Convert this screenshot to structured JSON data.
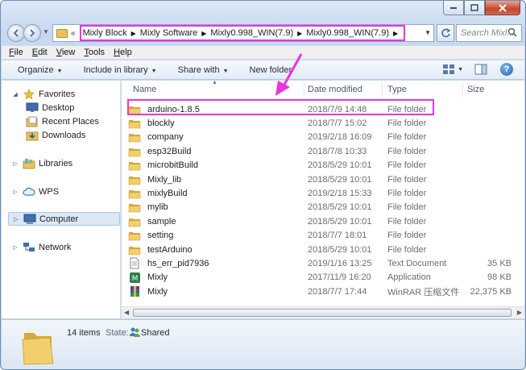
{
  "window": {
    "caption_buttons": [
      "minimize",
      "maximize",
      "close"
    ]
  },
  "address": {
    "breadcrumbs": [
      "Mixly Block",
      "Mixly Software",
      "Mixly0.998_WIN(7.9)",
      "Mixly0.998_WIN(7.9)"
    ],
    "search_placeholder": "Search Mixl..."
  },
  "menu": [
    "File",
    "Edit",
    "View",
    "Tools",
    "Help"
  ],
  "commands": {
    "organize": "Organize",
    "include": "Include in library",
    "share": "Share with",
    "new_folder": "New folder"
  },
  "nav": {
    "favorites": "Favorites",
    "desktop": "Desktop",
    "recent": "Recent Places",
    "downloads": "Downloads",
    "libraries": "Libraries",
    "wps": "WPS",
    "computer": "Computer",
    "network": "Network"
  },
  "columns": {
    "name": "Name",
    "date": "Date modified",
    "type": "Type",
    "size": "Size"
  },
  "files": [
    {
      "name": "arduino-1.8.5",
      "date": "2018/7/9 14:48",
      "type": "File folder",
      "size": "",
      "icon": "folder-icon"
    },
    {
      "name": "blockly",
      "date": "2018/7/7 15:02",
      "type": "File folder",
      "size": "",
      "icon": "folder-icon"
    },
    {
      "name": "company",
      "date": "2019/2/18 16:09",
      "type": "File folder",
      "size": "",
      "icon": "folder-icon"
    },
    {
      "name": "esp32Build",
      "date": "2018/7/8 10:33",
      "type": "File folder",
      "size": "",
      "icon": "folder-icon"
    },
    {
      "name": "microbitBuild",
      "date": "2018/5/29 10:01",
      "type": "File folder",
      "size": "",
      "icon": "folder-icon"
    },
    {
      "name": "Mixly_lib",
      "date": "2018/5/29 10:01",
      "type": "File folder",
      "size": "",
      "icon": "folder-icon"
    },
    {
      "name": "mixlyBuild",
      "date": "2019/2/18 15:33",
      "type": "File folder",
      "size": "",
      "icon": "folder-icon"
    },
    {
      "name": "mylib",
      "date": "2018/5/29 10:01",
      "type": "File folder",
      "size": "",
      "icon": "folder-icon"
    },
    {
      "name": "sample",
      "date": "2018/5/29 10:01",
      "type": "File folder",
      "size": "",
      "icon": "folder-icon"
    },
    {
      "name": "setting",
      "date": "2018/7/7 18:01",
      "type": "File folder",
      "size": "",
      "icon": "folder-icon"
    },
    {
      "name": "testArduino",
      "date": "2018/5/29 10:01",
      "type": "File folder",
      "size": "",
      "icon": "folder-icon"
    },
    {
      "name": "hs_err_pid7936",
      "date": "2019/1/16 13:25",
      "type": "Text Document",
      "size": "35 KB",
      "icon": "text-document-icon"
    },
    {
      "name": "Mixly",
      "date": "2017/11/9 16:20",
      "type": "Application",
      "size": "98 KB",
      "icon": "application-icon"
    },
    {
      "name": "Mixly",
      "date": "2018/7/7 17:44",
      "type": "WinRAR 压缩文件",
      "size": "22,375 KB",
      "icon": "winrar-archive-icon"
    }
  ],
  "details": {
    "count": "14 items",
    "state_label": "State:",
    "state_value": "Shared"
  },
  "colors": {
    "annotation": "#e936d9",
    "folder": "#e9c35a",
    "selection": "#dce8f6"
  }
}
